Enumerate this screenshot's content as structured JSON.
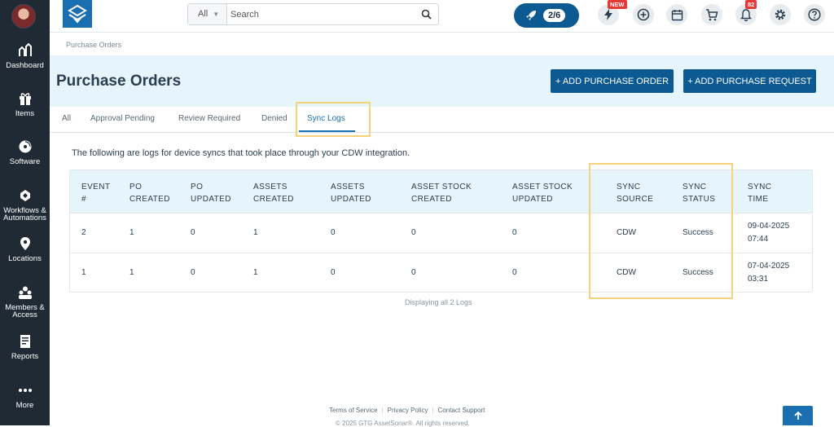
{
  "sidebar": {
    "items": [
      {
        "label": "Dashboard"
      },
      {
        "label": "Items"
      },
      {
        "label": "Software"
      },
      {
        "label_line1": "Workflows &",
        "label_line2": "Automations"
      },
      {
        "label": "Locations"
      },
      {
        "label_line1": "Members &",
        "label_line2": "Access"
      },
      {
        "label": "Reports"
      },
      {
        "label": "More"
      }
    ]
  },
  "topbar": {
    "search_scope": "All",
    "search_placeholder": "Search",
    "progress": "2/6",
    "new_badge": "NEW",
    "notification_count": "82"
  },
  "breadcrumb": "Purchase Orders",
  "page": {
    "title": "Purchase Orders",
    "add_po_button": "+ ADD PURCHASE ORDER",
    "add_request_button": "+ ADD PURCHASE REQUEST"
  },
  "tabs": [
    "All",
    "Approval Pending",
    "Review Required",
    "Denied",
    "Sync Logs"
  ],
  "active_tab": "Sync Logs",
  "intro": "The following are logs for device syncs that took place through your CDW integration.",
  "table": {
    "headers": [
      [
        "EVENT",
        "#"
      ],
      [
        "PO",
        "CREATED"
      ],
      [
        "PO",
        "UPDATED"
      ],
      [
        "ASSETS",
        "CREATED"
      ],
      [
        "ASSETS",
        "UPDATED"
      ],
      [
        "ASSET STOCK",
        "CREATED"
      ],
      [
        "ASSET STOCK",
        "UPDATED"
      ],
      [
        "SYNC",
        "SOURCE"
      ],
      [
        "SYNC",
        "STATUS"
      ],
      [
        "SYNC",
        "TIME"
      ]
    ],
    "rows": [
      {
        "event": "2",
        "po_created": "1",
        "po_updated": "0",
        "assets_created": "1",
        "assets_updated": "0",
        "stock_created": "0",
        "stock_updated": "0",
        "source": "CDW",
        "status": "Success",
        "time_date": "09-04-2025",
        "time_clock": "07:44"
      },
      {
        "event": "1",
        "po_created": "1",
        "po_updated": "0",
        "assets_created": "1",
        "assets_updated": "0",
        "stock_created": "0",
        "stock_updated": "0",
        "source": "CDW",
        "status": "Success",
        "time_date": "07-04-2025",
        "time_clock": "03:31"
      }
    ],
    "footnote": "Displaying all 2 Logs"
  },
  "footer": {
    "terms": "Terms of Service",
    "privacy": "Privacy Policy",
    "support": "Contact Support",
    "copyright": "© 2025 GTG AssetSonar®. All rights reserved."
  },
  "colors": {
    "sidebar_bg": "#1f2a35",
    "primary": "#0d5a93",
    "accent": "#1a6fb0",
    "header_band": "#e6f4fb",
    "highlight": "#f6d27a",
    "badge": "#e53935"
  }
}
